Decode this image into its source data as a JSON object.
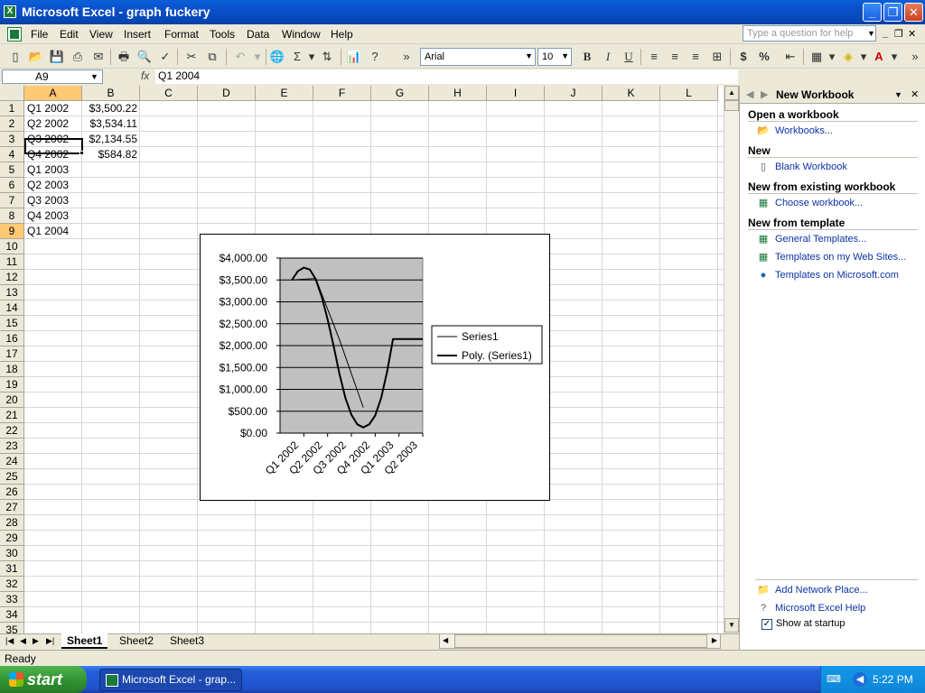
{
  "window": {
    "title": "Microsoft Excel - graph fuckery",
    "icon": "excel-icon"
  },
  "menu": [
    "File",
    "Edit",
    "View",
    "Insert",
    "Format",
    "Tools",
    "Data",
    "Window",
    "Help"
  ],
  "help_box": {
    "placeholder": "Type a question for help"
  },
  "toolbar": {
    "font_name": "Arial",
    "font_size": "10",
    "bold": "B",
    "italic": "I",
    "underline": "U"
  },
  "formula_bar": {
    "name_box": "A9",
    "fx": "fx",
    "content": "Q1 2004"
  },
  "grid": {
    "columns": [
      "A",
      "B",
      "C",
      "D",
      "E",
      "F",
      "G",
      "H",
      "I",
      "J",
      "K",
      "L"
    ],
    "rows": [
      "1",
      "2",
      "3",
      "4",
      "5",
      "6",
      "7",
      "8",
      "9",
      "10",
      "11",
      "12",
      "13",
      "14",
      "15",
      "16",
      "17",
      "18",
      "19",
      "20",
      "21",
      "22",
      "23",
      "24",
      "25",
      "26",
      "27",
      "28",
      "29",
      "30",
      "31",
      "32",
      "33",
      "34",
      "35"
    ],
    "cells_a": [
      "Q1 2002",
      "Q2 2002",
      "Q3 2002",
      "Q4 2002",
      "Q1 2003",
      "Q2 2003",
      "Q3 2003",
      "Q4 2003",
      "Q1 2004"
    ],
    "cells_b": [
      "$3,500.22",
      "$3,534.11",
      "$2,134.55",
      "$584.82"
    ]
  },
  "chart_data": {
    "type": "line",
    "categories": [
      "Q1 2002",
      "Q2 2002",
      "Q3 2002",
      "Q4 2002",
      "Q1 2003",
      "Q2 2003"
    ],
    "ytick_labels": [
      "$4,000.00",
      "$3,500.00",
      "$3,000.00",
      "$2,500.00",
      "$2,000.00",
      "$1,500.00",
      "$1,000.00",
      "$500.00",
      "$0.00"
    ],
    "ylim": [
      0,
      4000
    ],
    "series": [
      {
        "name": "Series1",
        "values": [
          3500.22,
          3534.11,
          2134.55,
          584.82
        ]
      },
      {
        "name": "Poly. (Series1)",
        "x": [
          0.0,
          0.25,
          0.5,
          0.75,
          1.0,
          1.25,
          1.5,
          1.75,
          2.0,
          2.25,
          2.5,
          2.75,
          3.0,
          3.25,
          3.5,
          3.75,
          4.0,
          4.25,
          4.5,
          4.75,
          5.0,
          5.25,
          5.5
        ],
        "values": [
          3500,
          3700,
          3780,
          3740,
          3520,
          3120,
          2600,
          2000,
          1350,
          800,
          420,
          200,
          130,
          200,
          400,
          800,
          1400,
          2150,
          2150,
          2150,
          2150,
          2150,
          2150
        ]
      }
    ],
    "plot_bg": "#c0c0c0",
    "grid": true,
    "legend": "right"
  },
  "sheets": [
    "Sheet1",
    "Sheet2",
    "Sheet3"
  ],
  "status": "Ready",
  "task_pane": {
    "title": "New Workbook",
    "sections": [
      {
        "heading": "Open a workbook",
        "links": [
          "Workbooks..."
        ]
      },
      {
        "heading": "New",
        "links": [
          "Blank Workbook"
        ]
      },
      {
        "heading": "New from existing workbook",
        "links": [
          "Choose workbook..."
        ]
      },
      {
        "heading": "New from template",
        "links": [
          "General Templates...",
          "Templates on my Web Sites...",
          "Templates on Microsoft.com"
        ]
      }
    ],
    "bottom_links": [
      "Add Network Place...",
      "Microsoft Excel Help"
    ],
    "show_at_startup": "Show at startup"
  },
  "taskbar": {
    "start": "start",
    "task": "Microsoft Excel - grap...",
    "clock": "5:22 PM"
  }
}
